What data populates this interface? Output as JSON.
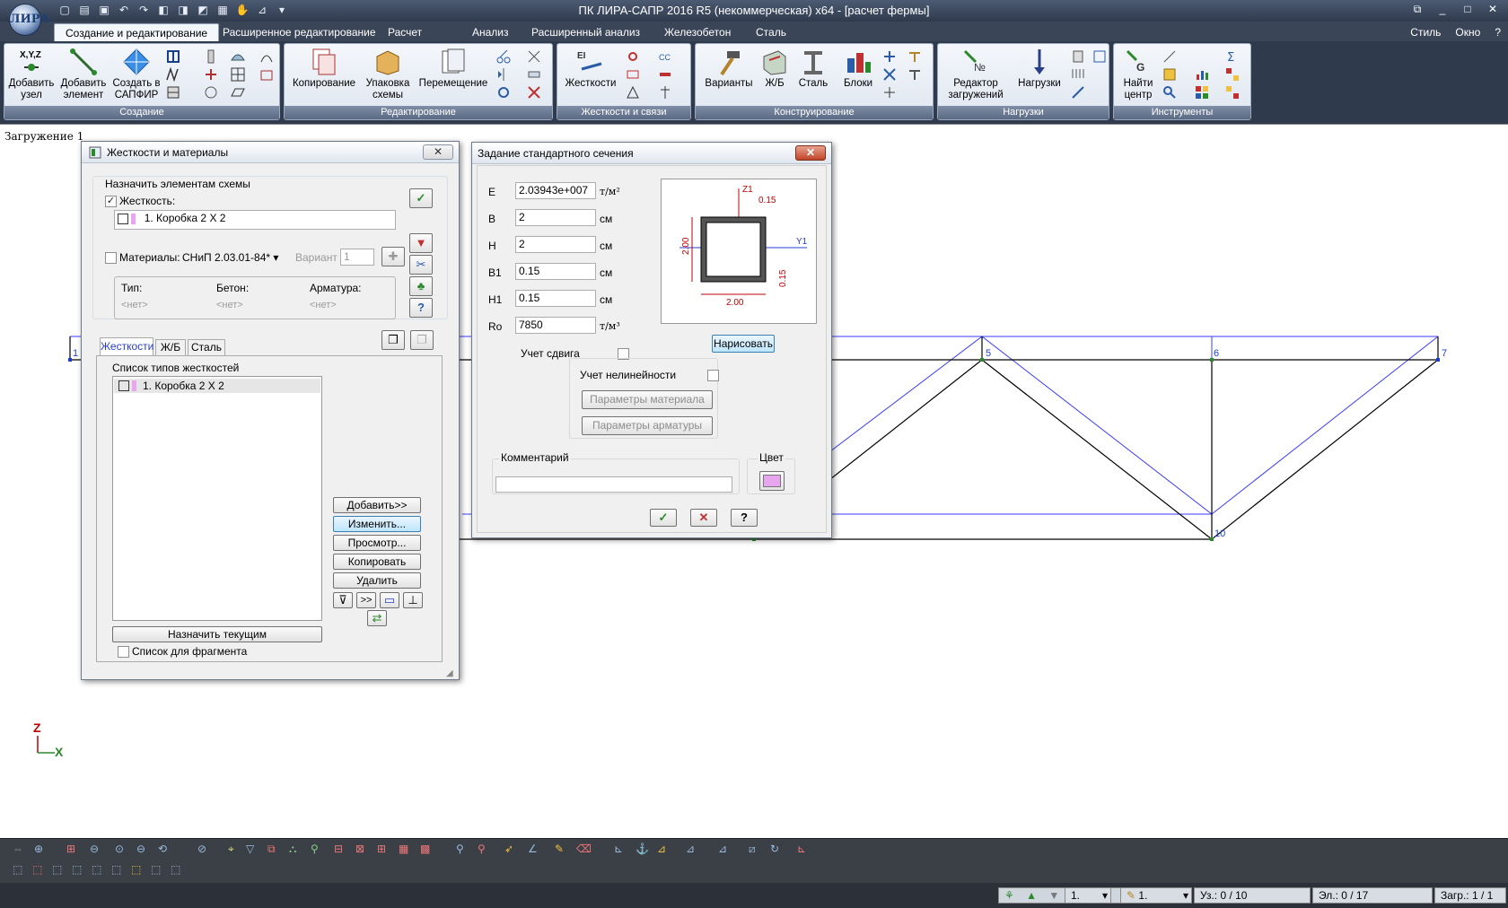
{
  "window": {
    "title": "ПК ЛИРА-САПР  2016 R5 (некоммерческая) x64 - [расчет фермы]",
    "logo": "ЛИРА"
  },
  "menu": {
    "tabs": [
      "Создание и редактирование",
      "Расширенное редактирование",
      "Расчет",
      "Анализ",
      "Расширенный анализ",
      "Железобетон",
      "Сталь"
    ],
    "active_tab": 0,
    "right": {
      "style": "Стиль",
      "window": "Окно",
      "help": "?"
    }
  },
  "ribbon": {
    "groups": [
      {
        "label": "Создание"
      },
      {
        "label": "Редактирование"
      },
      {
        "label": "Жесткости и связи"
      },
      {
        "label": "Конструирование"
      },
      {
        "label": "Нагрузки"
      },
      {
        "label": "Инструменты"
      }
    ],
    "buttons": {
      "add_node": "Добавить узел",
      "add_element": "Добавить элемент",
      "create_sapfir": "Создать в САПФИР",
      "copy": "Копирование",
      "pack_scheme": "Упаковка схемы",
      "move": "Перемещение",
      "stiffness": "Жесткости",
      "variants": "Варианты",
      "rc": "Ж/Б",
      "steel": "Сталь",
      "blocks": "Блоки",
      "load_editor": "Редактор загружений",
      "loads": "Нагрузки",
      "find_center": "Найти центр"
    },
    "xyz_label": "X,Y,Z",
    "ei_label": "EI"
  },
  "canvas": {
    "load_case": "Загружение 1",
    "node_labels": [
      "1",
      "5",
      "6",
      "7",
      "9",
      "10"
    ],
    "axis": {
      "z": "Z",
      "x": "X"
    }
  },
  "stiffness_dialog": {
    "title": "Жесткости и материалы",
    "assign_group": "Назначить элементам схемы",
    "stiffness_label": "Жесткость:",
    "stiffness_checked": true,
    "current_stiffness": "1. Коробка 2 X 2",
    "materials_label": "Материалы:",
    "materials_checked": false,
    "norm": "СНиП 2.03.01-84*",
    "variant_label": "Вариант",
    "variant_value": "1",
    "columns": [
      "Тип:",
      "Бетон:",
      "Арматура:"
    ],
    "none_values": [
      "<нет>",
      "<нет>",
      "<нет>"
    ],
    "tabs": [
      "Жесткости",
      "Ж/Б",
      "Сталь"
    ],
    "list_label": "Список типов жесткостей",
    "list_items": [
      "1. Коробка 2 X 2"
    ],
    "buttons": {
      "add": "Добавить>>",
      "edit": "Изменить...",
      "view": "Просмотр...",
      "copy": "Копировать",
      "delete": "Удалить",
      "assign_current": "Назначить текущим",
      "more": ">>"
    },
    "fragment_list_label": "Список для фрагмента",
    "fragment_checked": false
  },
  "section_dialog": {
    "title": "Задание стандартного сечения",
    "params": [
      {
        "name": "E",
        "value": "2.03943e+007",
        "unit": "т/м²"
      },
      {
        "name": "B",
        "value": "2",
        "unit": "см"
      },
      {
        "name": "H",
        "value": "2",
        "unit": "см"
      },
      {
        "name": "B1",
        "value": "0.15",
        "unit": "см"
      },
      {
        "name": "H1",
        "value": "0.15",
        "unit": "см"
      },
      {
        "name": "Ro",
        "value": "7850",
        "unit": "т/м³"
      }
    ],
    "shear_label": "Учет сдвига",
    "shear_checked": false,
    "nonlinear_label": "Учет нелинейности",
    "nonlinear_checked": false,
    "material_params_button": "Параметры материала",
    "rebar_params_button": "Параметры арматуры",
    "draw_button": "Нарисовать",
    "comment_label": "Комментарий",
    "comment_value": "",
    "color_label": "Цвет",
    "color_value": "#e8a6ee",
    "preview": {
      "axis_z": "Z1",
      "axis_y": "Y1",
      "top_thickness": "0.15",
      "right_thickness": "0.15",
      "width": "2.00",
      "height": "2.00"
    }
  },
  "statusbar": {
    "combo1": "1.",
    "combo2": "1.",
    "nodes": "Уз.: 0 / 10",
    "elements": "Эл.: 0 / 17",
    "loads": "Загр.: 1 / 1"
  },
  "colors": {
    "ribbon_bg": "#2f3a4d",
    "frame_black": "#000000",
    "frame_blue": "#3b3bff",
    "dim_red": "#c00000"
  }
}
